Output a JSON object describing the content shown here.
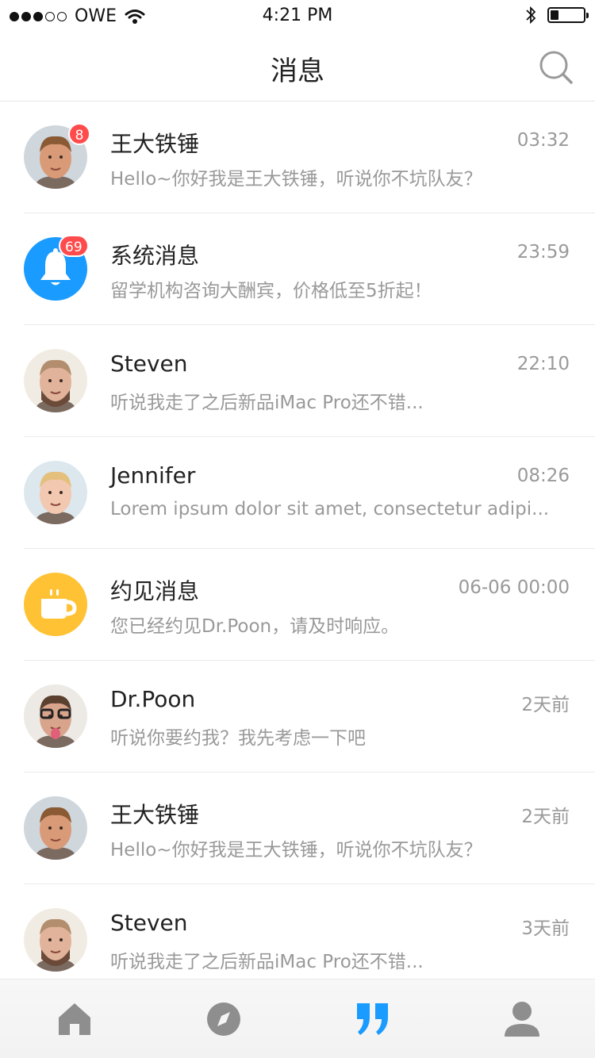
{
  "status_bar": {
    "carrier": "OWE",
    "signal_bars_filled": 3,
    "signal_bars_total": 5,
    "time": "4:21 PM",
    "battery_level": 0.25
  },
  "header": {
    "title": "消息"
  },
  "colors": {
    "accent": "#1a9bff",
    "badge": "#ff4b4b",
    "muted": "#999999",
    "coffee": "#ffc234"
  },
  "messages": [
    {
      "name": "王大铁锤",
      "time": "03:32",
      "preview": "Hello~你好我是王大铁锤，听说你不坑队友？",
      "badge": "8",
      "avatar": "avatar-man-young"
    },
    {
      "name": "系统消息",
      "time": "23:59",
      "preview": "留学机构咨询大酬宾，价格低至5折起！",
      "badge": "69",
      "avatar": "bell-icon"
    },
    {
      "name": "Steven",
      "time": "22:10",
      "preview": "听说我走了之后新品iMac Pro还不错...",
      "badge": "",
      "avatar": "avatar-man-beard"
    },
    {
      "name": "Jennifer",
      "time": "08:26",
      "preview": "Lorem ipsum dolor sit amet, consectetur adipi...",
      "badge": "",
      "avatar": "avatar-woman"
    },
    {
      "name": "约见消息",
      "time": "06-06 00:00",
      "preview": "您已经约见Dr.Poon，请及时响应。",
      "badge": "",
      "avatar": "coffee-icon"
    },
    {
      "name": "Dr.Poon",
      "time": "2天前",
      "preview": "听说你要约我？我先考虑一下吧",
      "badge": "",
      "avatar": "avatar-man-glasses"
    },
    {
      "name": "王大铁锤",
      "time": "2天前",
      "preview": "Hello~你好我是王大铁锤，听说你不坑队友？",
      "badge": "",
      "avatar": "avatar-man-young"
    },
    {
      "name": "Steven",
      "time": "3天前",
      "preview": "听说我走了之后新品iMac Pro还不错...",
      "badge": "",
      "avatar": "avatar-man-beard"
    }
  ],
  "tabs": [
    {
      "icon": "home-icon",
      "active": false
    },
    {
      "icon": "compass-icon",
      "active": false
    },
    {
      "icon": "quote-icon",
      "active": true
    },
    {
      "icon": "person-icon",
      "active": false
    }
  ]
}
